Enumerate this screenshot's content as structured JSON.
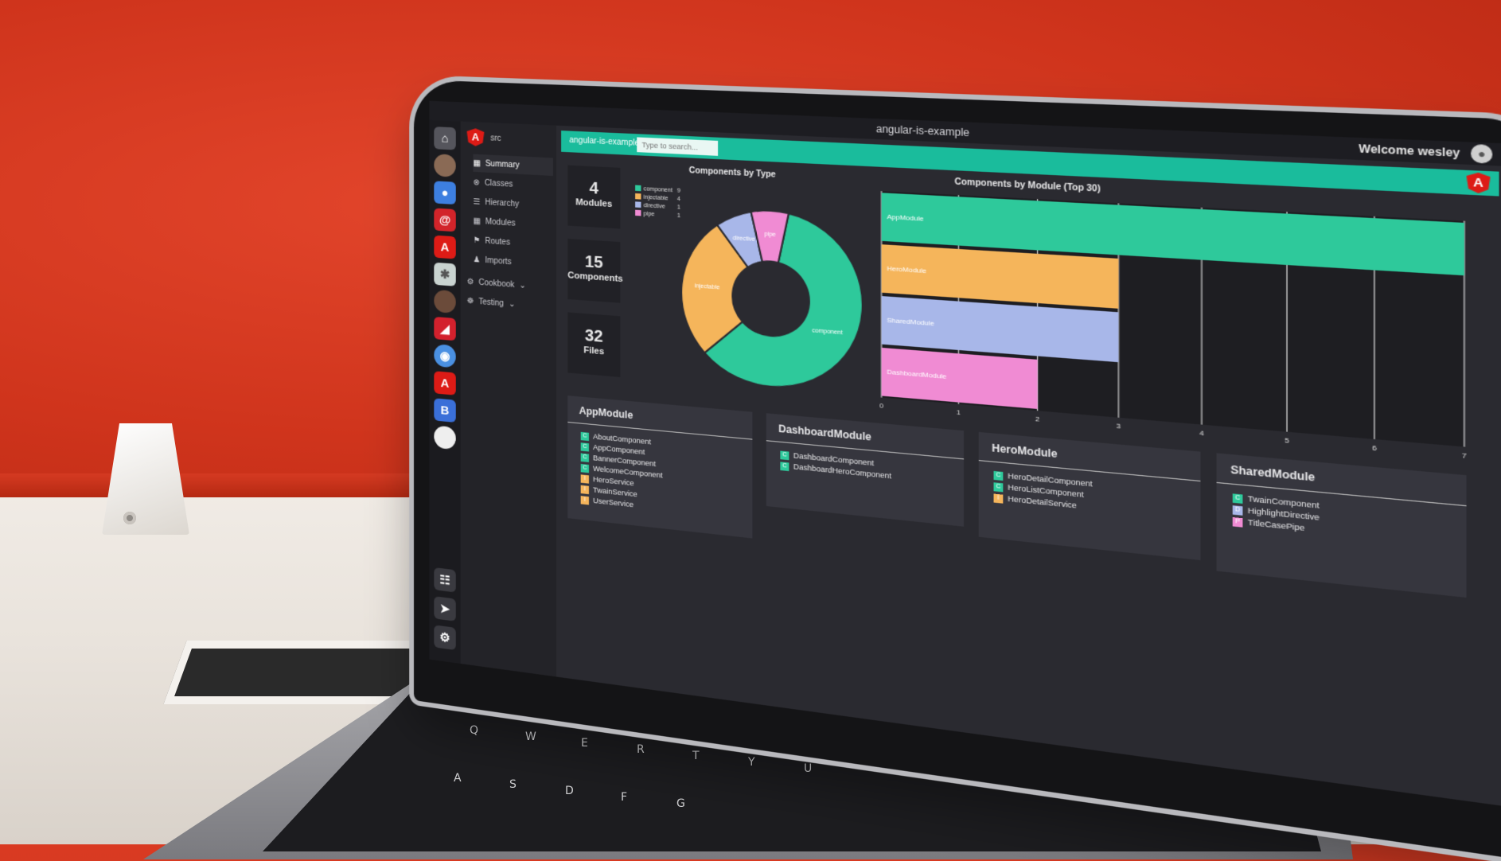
{
  "app": {
    "window_title": "angular-is-example",
    "welcome": "Welcome wesley",
    "project_tab": "angular-is-example",
    "search_placeholder": "Type to search...",
    "nav_source": "src"
  },
  "nav": {
    "items": [
      {
        "label": "Summary",
        "icon": "summary-icon",
        "active": true
      },
      {
        "label": "Classes",
        "icon": "classes-icon"
      },
      {
        "label": "Hierarchy",
        "icon": "hierarchy-icon"
      },
      {
        "label": "Modules",
        "icon": "modules-icon"
      },
      {
        "label": "Routes",
        "icon": "routes-icon"
      },
      {
        "label": "Imports",
        "icon": "imports-icon"
      },
      {
        "label": "Cookbook",
        "icon": "cookbook-icon"
      },
      {
        "label": "Testing",
        "icon": "testing-icon"
      }
    ]
  },
  "stats": [
    {
      "value": "4",
      "label": "Modules"
    },
    {
      "value": "15",
      "label": "Components"
    },
    {
      "value": "32",
      "label": "Files"
    }
  ],
  "dock_icons": [
    "home-icon",
    "avatar",
    "bootstrap-icon",
    "angular-icon",
    "angular-icon",
    "app-icon",
    "avatar",
    "angular-icon",
    "app-icon",
    "angular-icon",
    "bootstrap-icon",
    "avatar",
    "binoculars-icon",
    "pointer-icon",
    "bug-icon"
  ],
  "colors": {
    "accent": "#1abc9c",
    "component": "#2ec99b",
    "injectable": "#f5b55b",
    "directive": "#a8b7e9",
    "pipe": "#f08bd3",
    "angular": "#dd1b16"
  },
  "chart_data": [
    {
      "type": "pie",
      "title": "Components by Type",
      "labels": [
        "component",
        "injectable",
        "directive",
        "pipe"
      ],
      "values": [
        9,
        4,
        1,
        1
      ],
      "legend": "top-left"
    },
    {
      "type": "bar",
      "orientation": "horizontal",
      "title": "Components by Module (Top 30)",
      "categories": [
        "AppModule",
        "HeroModule",
        "SharedModule",
        "DashboardModule"
      ],
      "values": [
        7,
        3,
        3,
        2
      ],
      "xlim": [
        0,
        7
      ],
      "xticks": [
        "0",
        "1",
        "2",
        "3",
        "4",
        "5",
        "6",
        "7"
      ],
      "grid": true
    }
  ],
  "modules": [
    {
      "name": "AppModule",
      "items": [
        {
          "type": "C",
          "name": "AboutComponent"
        },
        {
          "type": "C",
          "name": "AppComponent"
        },
        {
          "type": "C",
          "name": "BannerComponent"
        },
        {
          "type": "C",
          "name": "WelcomeComponent"
        },
        {
          "type": "I",
          "name": "HeroService"
        },
        {
          "type": "I",
          "name": "TwainService"
        },
        {
          "type": "I",
          "name": "UserService"
        }
      ]
    },
    {
      "name": "DashboardModule",
      "items": [
        {
          "type": "C",
          "name": "DashboardComponent"
        },
        {
          "type": "C",
          "name": "DashboardHeroComponent"
        }
      ]
    },
    {
      "name": "HeroModule",
      "items": [
        {
          "type": "C",
          "name": "HeroDetailComponent"
        },
        {
          "type": "C",
          "name": "HeroListComponent"
        },
        {
          "type": "I",
          "name": "HeroDetailService"
        }
      ]
    },
    {
      "name": "SharedModule",
      "items": [
        {
          "type": "C",
          "name": "TwainComponent"
        },
        {
          "type": "D",
          "name": "HighlightDirective"
        },
        {
          "type": "P",
          "name": "TitleCasePipe"
        }
      ]
    }
  ]
}
